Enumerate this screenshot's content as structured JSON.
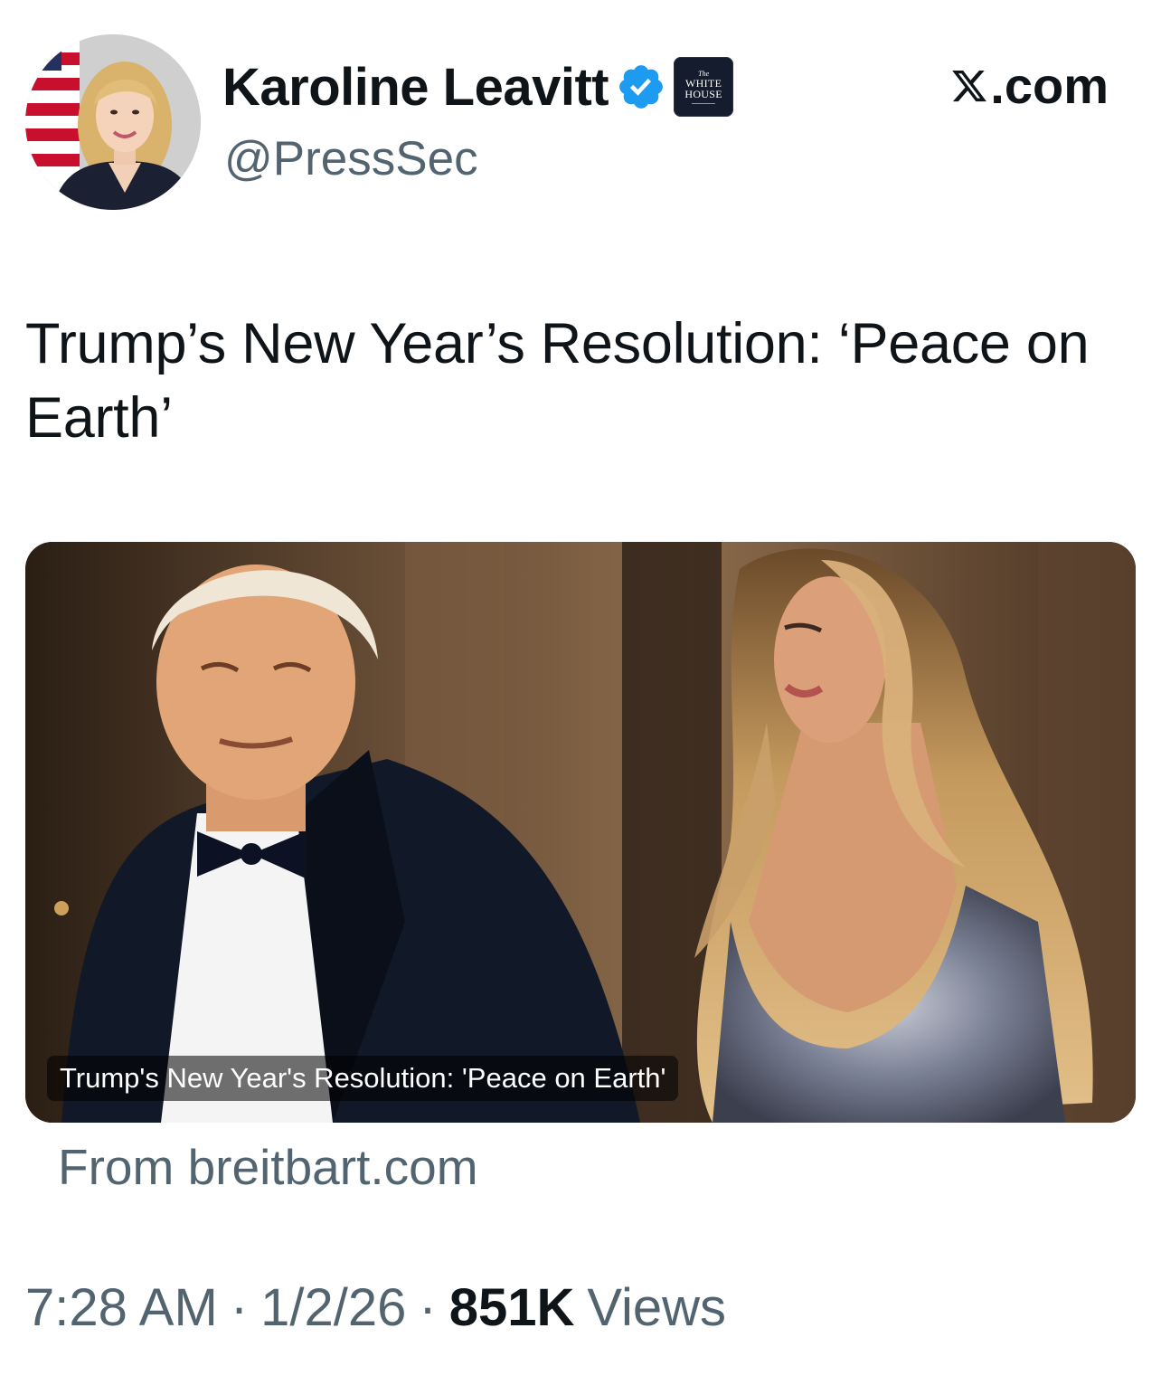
{
  "author": {
    "display_name": "Karoline Leavitt",
    "handle": "@PressSec",
    "verified_icon": "verified-badge-icon",
    "affiliate_badge": {
      "line1": "The",
      "line2": "WHITE",
      "line3": "HOUSE"
    }
  },
  "site": {
    "label": ".com",
    "logo_icon": "x-logo-icon"
  },
  "tweet": {
    "text": "Trump’s New Year’s Resolution: ‘Peace on Earth’"
  },
  "card": {
    "caption": "Trump's New Year's Resolution: 'Peace on Earth'",
    "source": "From breitbart.com"
  },
  "meta": {
    "time": "7:28 AM",
    "separator": "·",
    "date": "1/2/26",
    "views_count": "851K",
    "views_label": "Views"
  },
  "colors": {
    "text_primary": "#0f1419",
    "text_secondary": "#536471",
    "verified_blue": "#1d9bf0",
    "affiliate_bg": "#141c2e"
  }
}
